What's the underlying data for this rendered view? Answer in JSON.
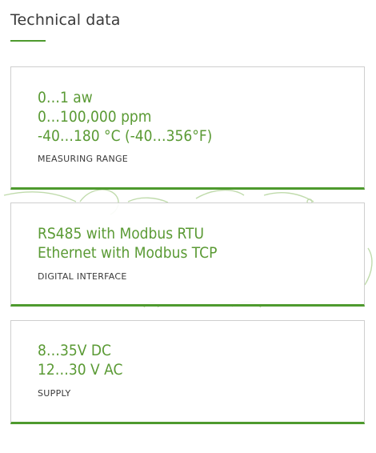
{
  "section": {
    "title": "Technical data"
  },
  "colors": {
    "accent": "#4e9a2e",
    "value_text": "#5a9a34",
    "label_text": "#3a3a3a",
    "card_border": "#cfcfcf"
  },
  "cards": [
    {
      "values": [
        "0…1 aw",
        "0…100,000 ppm",
        "-40…180 °C (-40…356°F)"
      ],
      "label": "MEASURING RANGE"
    },
    {
      "values": [
        "RS485 with Modbus RTU",
        "Ethernet with Modbus TCP"
      ],
      "label": "DIGITAL INTERFACE"
    },
    {
      "values": [
        "8…35V DC",
        "12…30 V AC"
      ],
      "label": "SUPPLY"
    }
  ]
}
